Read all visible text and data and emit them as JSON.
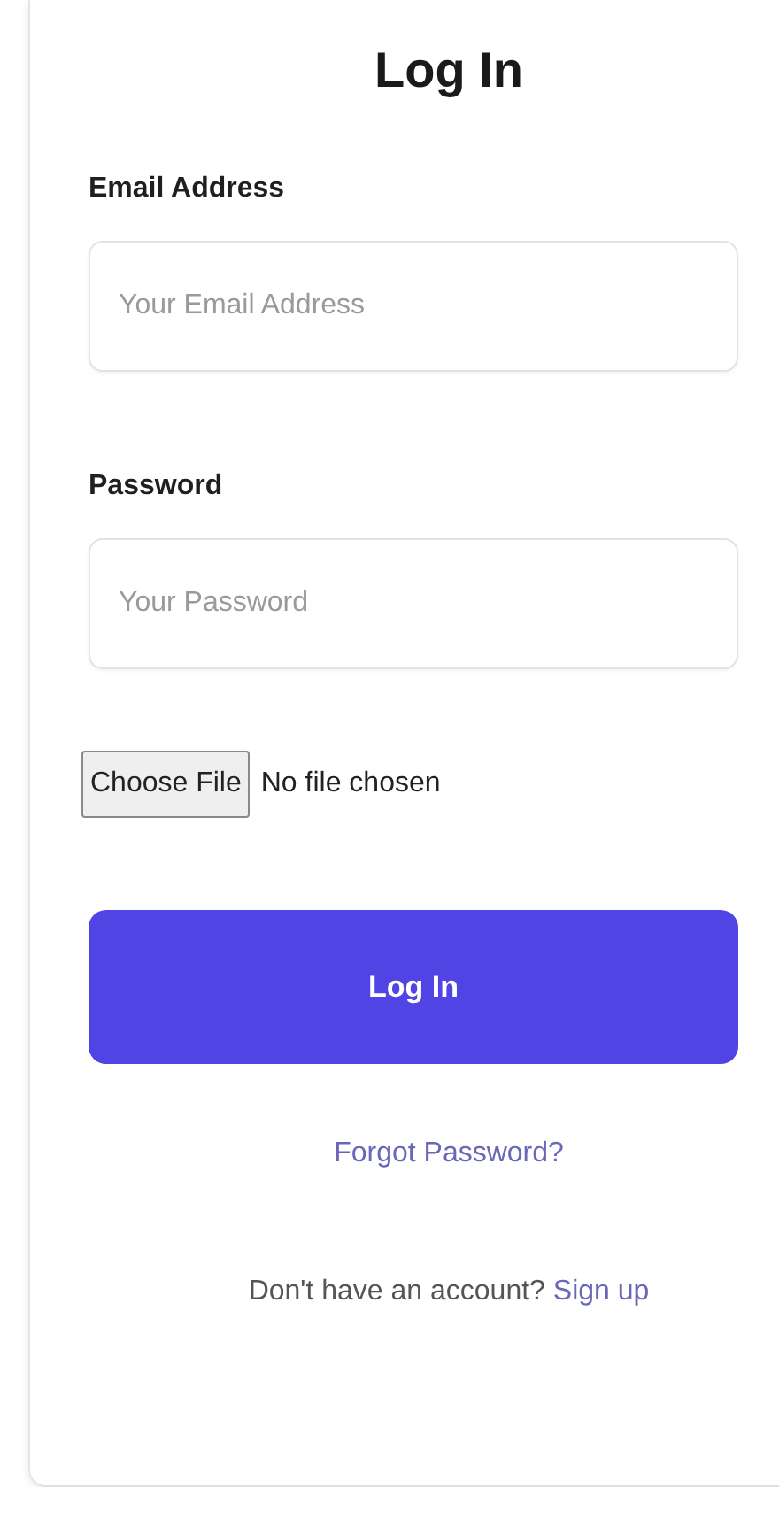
{
  "title": "Log In",
  "fields": [
    {
      "label": "Email Address",
      "placeholder": "Your Email Address"
    },
    {
      "label": "Password",
      "placeholder": "Your Password"
    }
  ],
  "file": {
    "button": "Choose File",
    "status": "No file chosen"
  },
  "submit": "Log In",
  "forgot": "Forgot Password?",
  "signup": {
    "prompt": "Don't have an account?",
    "link": "Sign up"
  }
}
